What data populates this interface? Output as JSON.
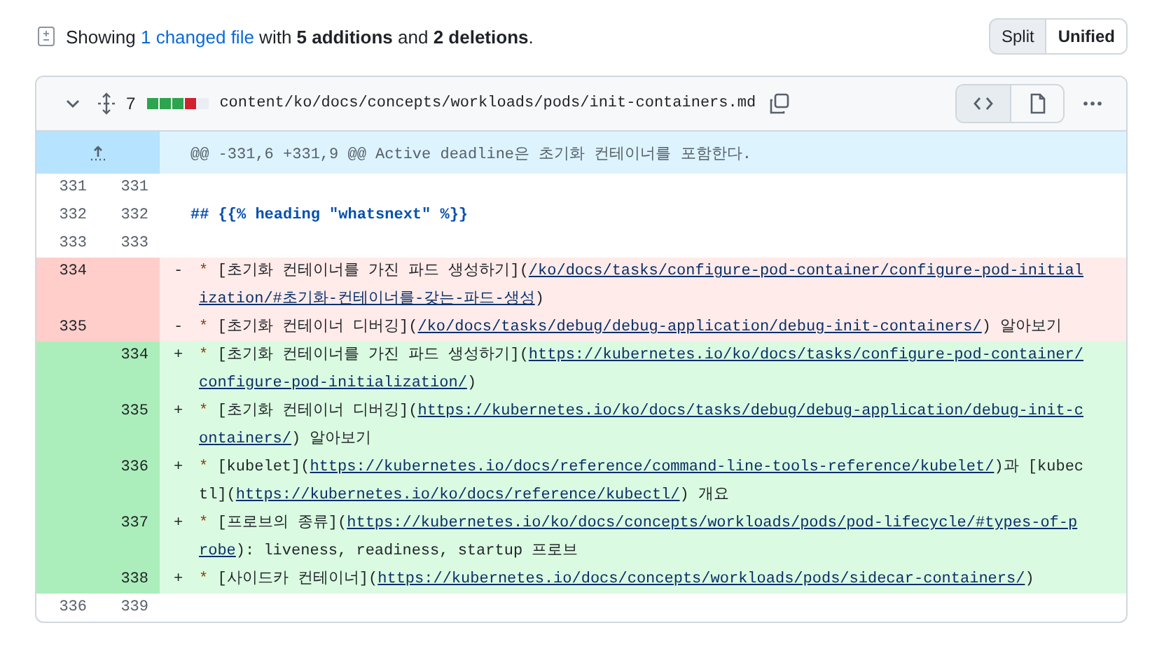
{
  "summary": {
    "prefix": "Showing ",
    "link": "1 changed file",
    "rest": " with **5 additions** and **2 deletions**."
  },
  "view_toggle": [
    {
      "label": "Split",
      "selected": false
    },
    {
      "label": "Unified",
      "selected": true
    }
  ],
  "file": {
    "expanded": true,
    "change_count": "7",
    "stat_blocks": [
      {
        "kind": "added"
      },
      {
        "kind": "added"
      },
      {
        "kind": "added"
      },
      {
        "kind": "deleted"
      },
      {
        "kind": "neutral"
      }
    ],
    "path": "content/ko/docs/concepts/workloads/pods/init-containers.md",
    "view_buttons": [
      {
        "kind": "code",
        "selected": true
      },
      {
        "kind": "file",
        "selected": false
      }
    ]
  },
  "hunk": {
    "header": "@@ -331,6 +331,9 @@ Active deadline은 초기화 컨테이너를 포함한다."
  },
  "lines": [
    {
      "kind": "context",
      "old": "331",
      "new": "331"
    },
    {
      "kind": "context",
      "old": "332",
      "new": "332",
      "segments": [
        {
          "kind": "heading",
          "text": "## {{% heading \"whatsnext\" %}}"
        }
      ]
    },
    {
      "kind": "context",
      "old": "333",
      "new": "333"
    },
    {
      "kind": "deletion",
      "old": "334",
      "sign": "-",
      "segments": [
        {
          "kind": "bullet",
          "text": "*"
        },
        {
          "kind": "text",
          "text": " [초기화 컨테이너를 가진 파드 생성하기]("
        },
        {
          "kind": "link",
          "text": "/ko/docs/tasks/configure-pod-container/configure-pod-initialization/#초기화-컨테이너를-갖는-파드-생성"
        },
        {
          "kind": "text",
          "text": ")"
        }
      ]
    },
    {
      "kind": "deletion",
      "old": "335",
      "sign": "-",
      "segments": [
        {
          "kind": "bullet",
          "text": "*"
        },
        {
          "kind": "text",
          "text": " [초기화 컨테이너 디버깅]("
        },
        {
          "kind": "link",
          "text": "/ko/docs/tasks/debug/debug-application/debug-init-containers/"
        },
        {
          "kind": "text",
          "text": ") 알아보기"
        }
      ]
    },
    {
      "kind": "addition",
      "new": "334",
      "sign": "+",
      "segments": [
        {
          "kind": "bullet",
          "text": "*"
        },
        {
          "kind": "text",
          "text": " [초기화 컨테이너를 가진 파드 생성하기]("
        },
        {
          "kind": "link",
          "text": "https://kubernetes.io/ko/docs/tasks/configure-pod-container/configure-pod-initialization/"
        },
        {
          "kind": "text",
          "text": ")"
        }
      ]
    },
    {
      "kind": "addition",
      "new": "335",
      "sign": "+",
      "segments": [
        {
          "kind": "bullet",
          "text": "*"
        },
        {
          "kind": "text",
          "text": " [초기화 컨테이너 디버깅]("
        },
        {
          "kind": "link",
          "text": "https://kubernetes.io/ko/docs/tasks/debug/debug-application/debug-init-containers/"
        },
        {
          "kind": "text",
          "text": ") 알아보기"
        }
      ]
    },
    {
      "kind": "addition",
      "new": "336",
      "sign": "+",
      "segments": [
        {
          "kind": "bullet",
          "text": "*"
        },
        {
          "kind": "text",
          "text": " [kubelet]("
        },
        {
          "kind": "link",
          "text": "https://kubernetes.io/docs/reference/command-line-tools-reference/kubelet/"
        },
        {
          "kind": "text",
          "text": ")과 [kubectl]("
        },
        {
          "kind": "link",
          "text": "https://kubernetes.io/ko/docs/reference/kubectl/"
        },
        {
          "kind": "text",
          "text": ") 개요"
        }
      ]
    },
    {
      "kind": "addition",
      "new": "337",
      "sign": "+",
      "segments": [
        {
          "kind": "bullet",
          "text": "*"
        },
        {
          "kind": "text",
          "text": " [프로브의 종류]("
        },
        {
          "kind": "link",
          "text": "https://kubernetes.io/ko/docs/concepts/workloads/pods/pod-lifecycle/#types-of-probe"
        },
        {
          "kind": "text",
          "text": "): liveness, readiness, startup 프로브"
        }
      ]
    },
    {
      "kind": "addition",
      "new": "338",
      "sign": "+",
      "segments": [
        {
          "kind": "bullet",
          "text": "*"
        },
        {
          "kind": "text",
          "text": " [사이드카 컨테이너]("
        },
        {
          "kind": "link",
          "text": "https://kubernetes.io/docs/concepts/workloads/pods/sidecar-containers/"
        },
        {
          "kind": "text",
          "text": ")"
        }
      ]
    },
    {
      "kind": "context",
      "old": "336",
      "new": "339"
    }
  ]
}
